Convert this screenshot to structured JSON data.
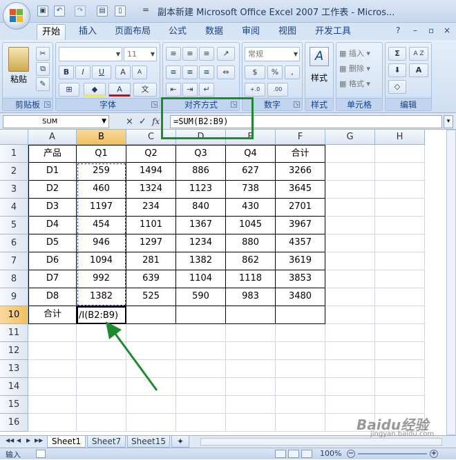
{
  "window": {
    "title": "副本新建 Microsoft Office Excel 2007 工作表 - Micros...",
    "qat_separator": "="
  },
  "tabs": [
    "开始",
    "插入",
    "页面布局",
    "公式",
    "数据",
    "审阅",
    "视图",
    "开发工具"
  ],
  "active_tab": "开始",
  "window_controls": {
    "help": "?",
    "minimize": "–",
    "restore": "▫",
    "close": "×"
  },
  "ribbon": {
    "groups": {
      "clipboard": {
        "label": "剪贴板",
        "paste": "粘贴"
      },
      "font": {
        "label": "字体",
        "font_size": "11",
        "bold": "B",
        "italic": "I",
        "underline": "U",
        "grow": "A",
        "shrink": "A",
        "font_color": "A",
        "phonetic": "文"
      },
      "alignment": {
        "label": "对齐方式"
      },
      "number": {
        "label": "数字",
        "format": "常规",
        "currency": "$",
        "percent": "%",
        "comma": ",",
        "inc_decimal": "+.0",
        "dec_decimal": ".00"
      },
      "styles": {
        "label": "样式",
        "styles_button": "样式"
      },
      "cells": {
        "label": "单元格",
        "insert": "插入",
        "delete": "删除",
        "format": "格式"
      },
      "editing": {
        "label": "编辑",
        "sum": "Σ",
        "sort": "A Z",
        "find": "A"
      }
    }
  },
  "formula_bar": {
    "name_box": "SUM",
    "cancel": "×",
    "enter": "✓",
    "fx": "fx",
    "formula": "=SUM(B2:B9)"
  },
  "grid": {
    "columns": [
      "A",
      "B",
      "C",
      "D",
      "E",
      "F",
      "G",
      "H"
    ],
    "row_numbers": [
      "1",
      "2",
      "3",
      "4",
      "5",
      "6",
      "7",
      "8",
      "9",
      "10",
      "11",
      "12",
      "13",
      "14",
      "15",
      "16"
    ],
    "table": [
      [
        "产品",
        "Q1",
        "Q2",
        "Q3",
        "Q4",
        "合计"
      ],
      [
        "D1",
        "259",
        "1494",
        "886",
        "627",
        "3266"
      ],
      [
        "D2",
        "460",
        "1324",
        "1123",
        "738",
        "3645"
      ],
      [
        "D3",
        "1197",
        "234",
        "840",
        "430",
        "2701"
      ],
      [
        "D4",
        "454",
        "1101",
        "1367",
        "1045",
        "3967"
      ],
      [
        "D5",
        "946",
        "1297",
        "1234",
        "880",
        "4357"
      ],
      [
        "D6",
        "1094",
        "281",
        "1382",
        "862",
        "3619"
      ],
      [
        "D7",
        "992",
        "639",
        "1104",
        "1118",
        "3853"
      ],
      [
        "D8",
        "1382",
        "525",
        "590",
        "983",
        "3480"
      ],
      [
        "合计",
        "",
        "",
        "",
        "",
        ""
      ]
    ],
    "active_cell_display": "/I(B2:B9)"
  },
  "sheets": [
    "Sheet1",
    "Sheet7",
    "Sheet15"
  ],
  "nav_buttons": [
    "◀◀",
    "◀",
    "▶",
    "▶▶"
  ],
  "status": {
    "mode": "输入",
    "zoom": "100%"
  },
  "colors": {
    "highlight": "#1c8b2c",
    "ribbon_text": "#15428b",
    "selected_header": "#f1c15f"
  },
  "watermark": {
    "brand": "Baidu经验",
    "url": "jingyan.baidu.com"
  }
}
